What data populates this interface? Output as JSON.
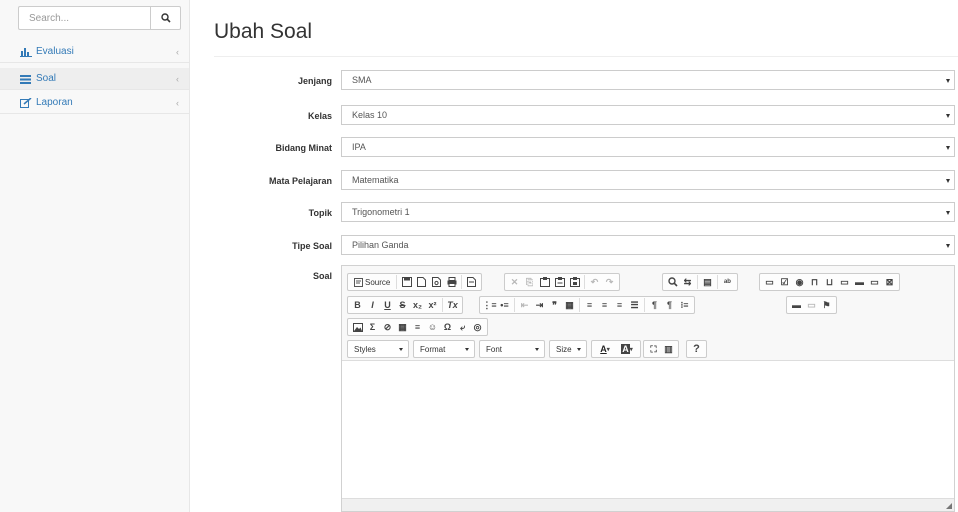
{
  "sidebar": {
    "search": {
      "placeholder": "Search...",
      "icon": "search-icon"
    },
    "items": [
      {
        "label": "Evaluasi",
        "icon": "bar-chart-icon",
        "active": false
      },
      {
        "label": "Soal",
        "icon": "list-icon",
        "active": true
      },
      {
        "label": "Laporan",
        "icon": "edit-icon",
        "active": false
      }
    ]
  },
  "main": {
    "title": "Ubah Soal",
    "fields": [
      {
        "label": "Jenjang",
        "value": "SMA"
      },
      {
        "label": "Kelas",
        "value": "Kelas 10"
      },
      {
        "label": "Bidang Minat",
        "value": "IPA"
      },
      {
        "label": "Mata Pelajaran",
        "value": "Matematika"
      },
      {
        "label": "Topik",
        "value": "Trigonometri 1"
      },
      {
        "label": "Tipe Soal",
        "value": "Pilihan Ganda"
      }
    ],
    "editor": {
      "label": "Soal",
      "source_label": "Source",
      "toolbar_row2": [
        "B",
        "I",
        "U",
        "S",
        "x₂",
        "x²",
        "Tx"
      ],
      "combos": [
        "Styles",
        "Format",
        "Font",
        "Size"
      ],
      "help_label": "?"
    }
  },
  "colors": {
    "link": "#337ab7",
    "sidebar_bg": "#f8f8f8",
    "border": "#cccccc"
  }
}
